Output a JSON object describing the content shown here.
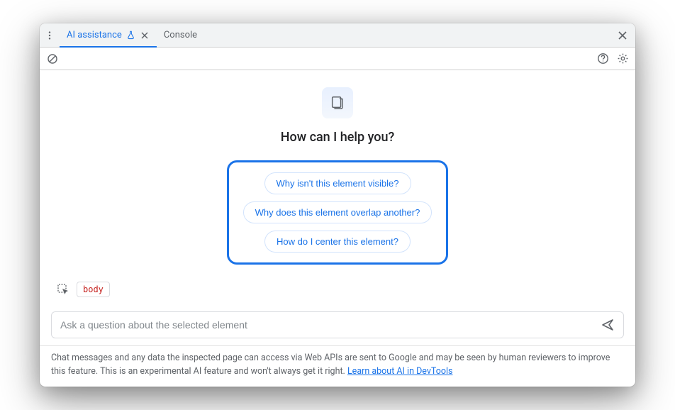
{
  "tabs": {
    "active": "AI assistance",
    "other": "Console"
  },
  "hero": {
    "title": "How can I help you?"
  },
  "suggestions": [
    "Why isn't this element visible?",
    "Why does this element overlap another?",
    "How do I center this element?"
  ],
  "context": {
    "selected_element": "body"
  },
  "input": {
    "placeholder": "Ask a question about the selected element"
  },
  "disclaimer": {
    "text": "Chat messages and any data the inspected page can access via Web APIs are sent to Google and may be seen by human reviewers to improve this feature. This is an experimental AI feature and won't always get it right. ",
    "link_text": "Learn about AI in DevTools"
  }
}
